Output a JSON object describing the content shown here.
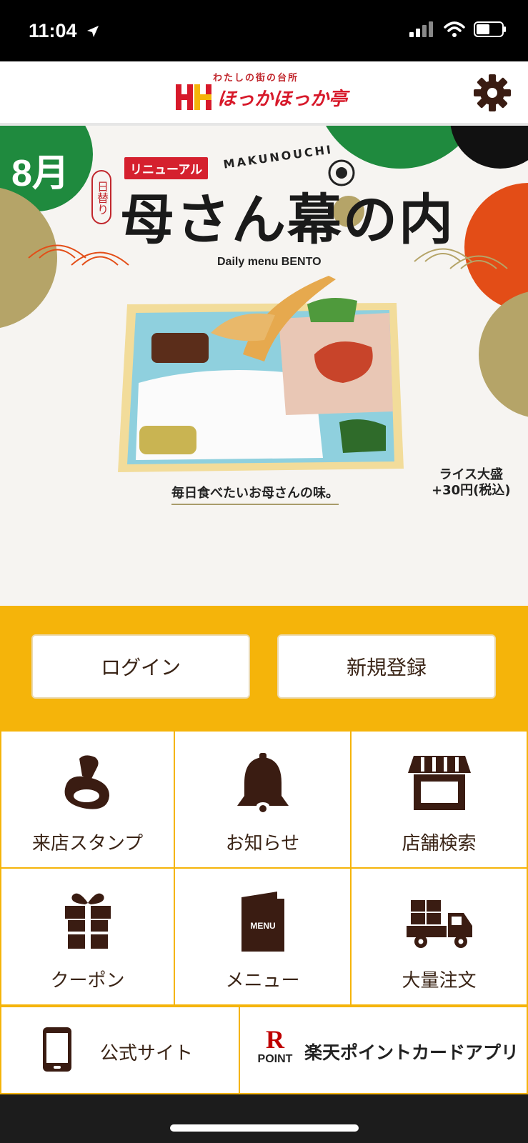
{
  "status_bar": {
    "time": "11:04"
  },
  "header": {
    "logo_tagline": "わたしの街の台所",
    "logo_name": "ほっかほっか亭",
    "brand_color": "#d7192a"
  },
  "banner": {
    "month": "8月",
    "renewal_badge": "リニューアル",
    "daily_tag": "日替り",
    "headline": "母さん幕の内",
    "makunouchi": "MAKUNOUCHI",
    "subtitle": "Daily menu BENTO",
    "catchphrase": "毎日食べたいお母さんの味。",
    "rice_note_line1": "ライス大盛",
    "rice_note_line2": "+30円(税込)"
  },
  "auth": {
    "login_label": "ログイン",
    "register_label": "新規登録",
    "band_color": "#f5b40a"
  },
  "grid": {
    "items": [
      {
        "label": "来店スタンプ",
        "icon": "stamp-icon"
      },
      {
        "label": "お知らせ",
        "icon": "bell-icon"
      },
      {
        "label": "店舗検索",
        "icon": "store-icon"
      },
      {
        "label": "クーポン",
        "icon": "gift-icon"
      },
      {
        "label": "メニュー",
        "icon": "menu-book-icon"
      },
      {
        "label": "大量注文",
        "icon": "delivery-truck-icon"
      }
    ],
    "menu_book_text": "MENU"
  },
  "bottom": {
    "official_site_label": "公式サイト",
    "rakuten_label": "楽天ポイントカードアプリ",
    "rakuten_logo_letter": "R",
    "rakuten_logo_text": "POINT"
  },
  "icon_color": "#3a1c12"
}
